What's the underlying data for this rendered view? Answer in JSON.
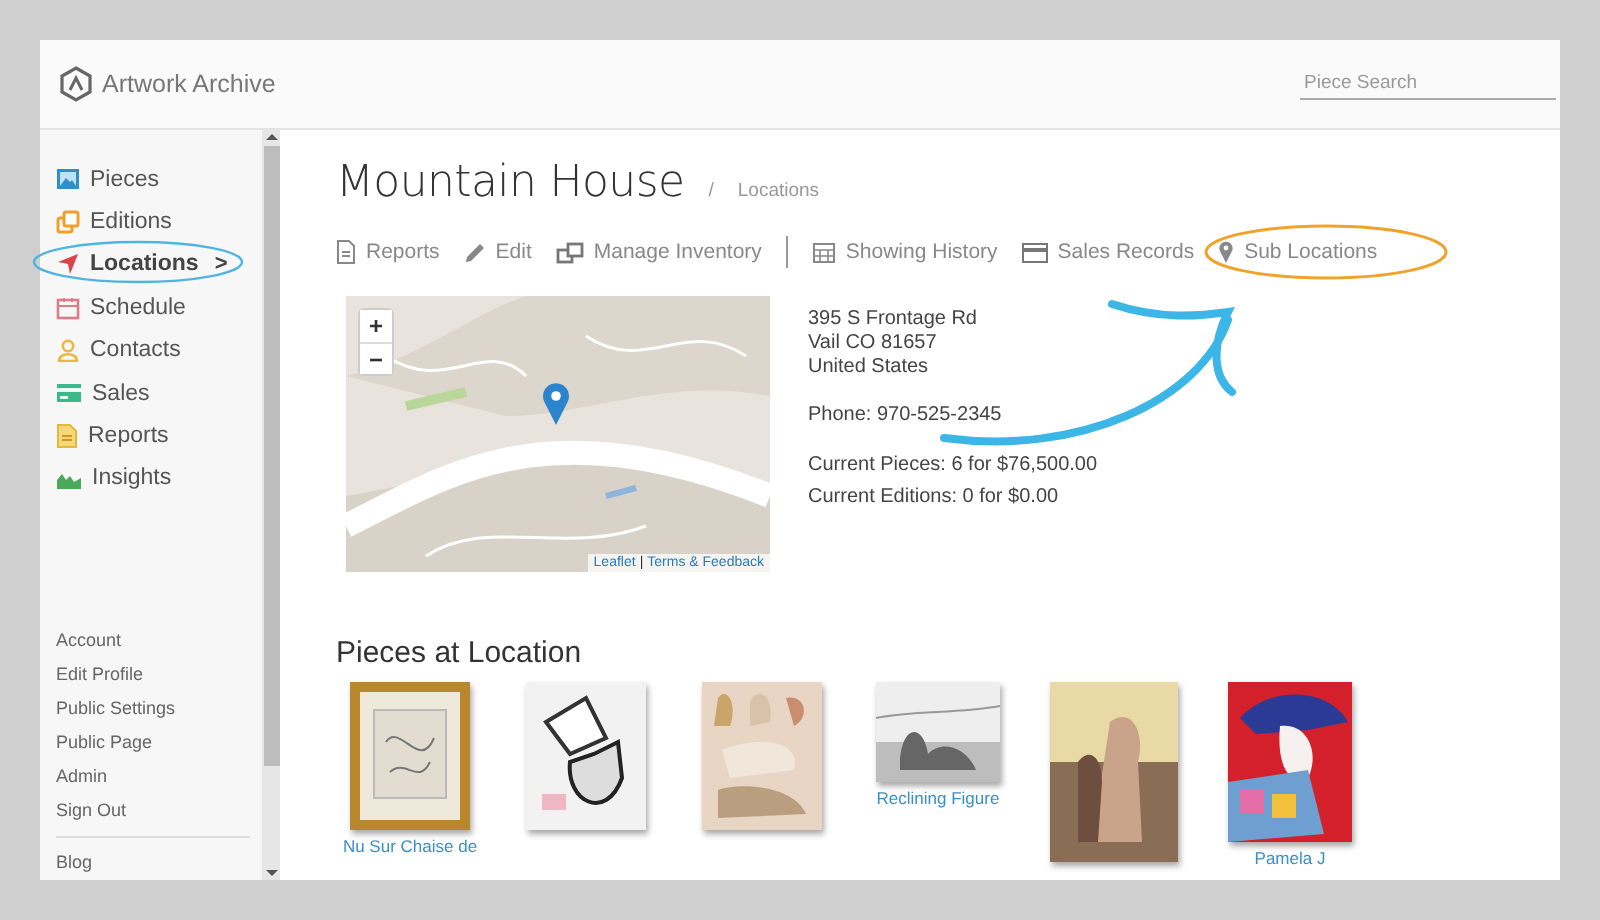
{
  "header": {
    "logo_text": "Artwork Archive",
    "search": {
      "placeholder": "Piece Search"
    }
  },
  "sidebar": {
    "items": [
      {
        "label": "Pieces",
        "selected": false
      },
      {
        "label": "Editions",
        "selected": false
      },
      {
        "label": "Locations",
        "selected": true
      },
      {
        "label": "Schedule",
        "selected": false
      },
      {
        "label": "Contacts",
        "selected": false
      },
      {
        "label": "Sales",
        "selected": false
      },
      {
        "label": "Reports",
        "selected": false
      },
      {
        "label": "Insights",
        "selected": false
      }
    ],
    "chevron": ">",
    "links": [
      "Account",
      "Edit Profile",
      "Public Settings",
      "Public Page",
      "Admin",
      "Sign Out"
    ],
    "footer_links": [
      "Blog"
    ]
  },
  "page": {
    "title": "Mountain House",
    "breadcrumb_separator": "/",
    "breadcrumb": "Locations",
    "actions": [
      {
        "label": "Reports"
      },
      {
        "label": "Edit"
      },
      {
        "label": "Manage Inventory"
      },
      {
        "label": "Showing History"
      },
      {
        "label": "Sales Records"
      },
      {
        "label": "Sub Locations"
      }
    ],
    "map": {
      "zoom_in": "+",
      "zoom_out": "−",
      "attribution": [
        {
          "label": "Leaflet"
        },
        {
          "label": "Terms & Feedback"
        }
      ],
      "attribution_separator": "|"
    },
    "address": [
      "395 S Frontage Rd",
      "Vail CO 81657",
      "United States"
    ],
    "phone": "Phone: 970-525-2345",
    "current_pieces": "Current Pieces: 6 for $76,500.00",
    "current_editions": "Current Editions: 0 for $0.00",
    "pieces_heading": "Pieces at Location",
    "pieces": [
      {
        "kind": "picture",
        "caption": "Nu Sur Chaise de"
      },
      {
        "kind": "picture"
      },
      {
        "kind": "picture"
      },
      {
        "kind": "picture",
        "caption": "Reclining Figure"
      },
      {
        "kind": "picture"
      },
      {
        "kind": "picture",
        "caption": "Pamela J"
      }
    ]
  }
}
